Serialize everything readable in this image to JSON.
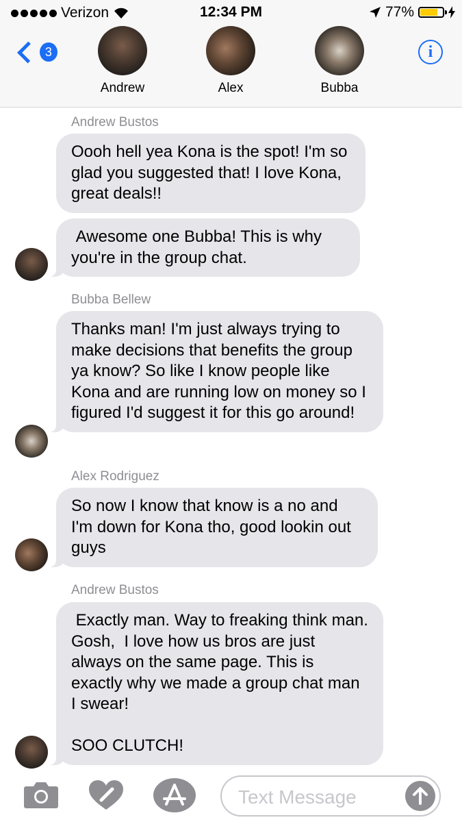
{
  "status": {
    "carrier": "Verizon",
    "time": "12:34 PM",
    "battery": "77%",
    "battery_level": 0.77
  },
  "header": {
    "back_count": "3",
    "contacts": [
      {
        "name": "Andrew"
      },
      {
        "name": "Alex"
      },
      {
        "name": "Bubba"
      }
    ],
    "info_label": "i"
  },
  "messages": [
    {
      "sender": "Andrew Bustos",
      "text": "Oooh hell yea Kona is the spot! I'm so glad you suggested that! I love Kona, great deals!!"
    },
    {
      "sender": "",
      "text": " Awesome one Bubba! This is why you're in the group chat."
    },
    {
      "sender": "Bubba  Bellew",
      "text": "Thanks man! I'm just always trying to make decisions that benefits the group ya know? So like I know people like Kona and are running low on money so I figured I'd suggest it for this go around!"
    },
    {
      "sender": "Alex Rodriguez",
      "text": "So now I know that know is a no and I'm down for Kona tho, good lookin out guys"
    },
    {
      "sender": "Andrew Bustos",
      "text": " Exactly man. Way to freaking think man. Gosh,  I love how us bros are just always on the same page. This is exactly why we made a group chat man I swear!\n\nSOO CLUTCH!"
    }
  ],
  "input": {
    "placeholder": "Text Message"
  }
}
